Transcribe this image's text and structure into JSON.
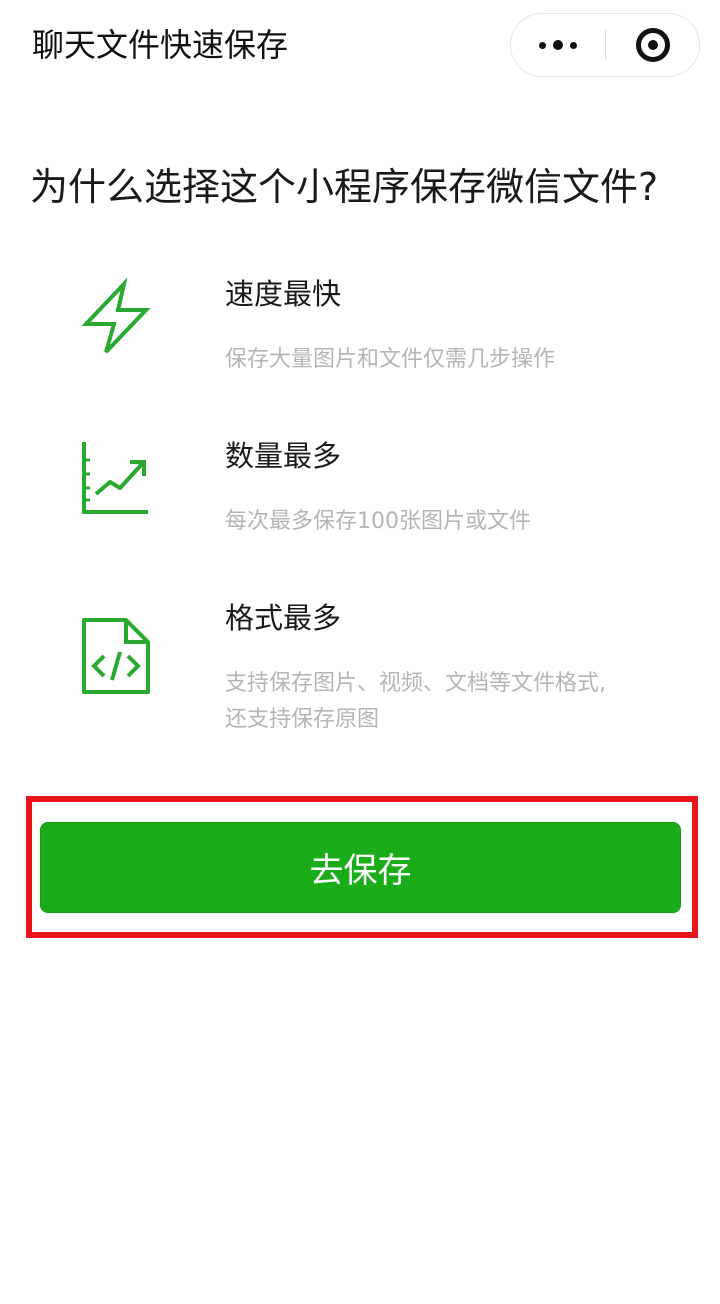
{
  "nav": {
    "title": "聊天文件快速保存",
    "more_icon": "more-dots-icon",
    "close_icon": "close-ring-icon"
  },
  "headline": "为什么选择这个小程序保存微信文件?",
  "features": [
    {
      "title": "速度最快",
      "desc": "保存大量图片和文件仅需几步操作",
      "icon": "lightning-icon"
    },
    {
      "title": "数量最多",
      "desc": "每次最多保存100张图片或文件",
      "icon": "growth-chart-icon"
    },
    {
      "title": "格式最多",
      "desc": "支持保存图片、视频、文档等文件格式,还支持保存原图",
      "icon": "code-file-icon"
    }
  ],
  "cta": {
    "label": "去保存"
  },
  "colors": {
    "accent_green": "#1aad19",
    "icon_green": "#2aa930",
    "highlight_red": "#e8161c",
    "muted_text": "#b5b5b5"
  }
}
